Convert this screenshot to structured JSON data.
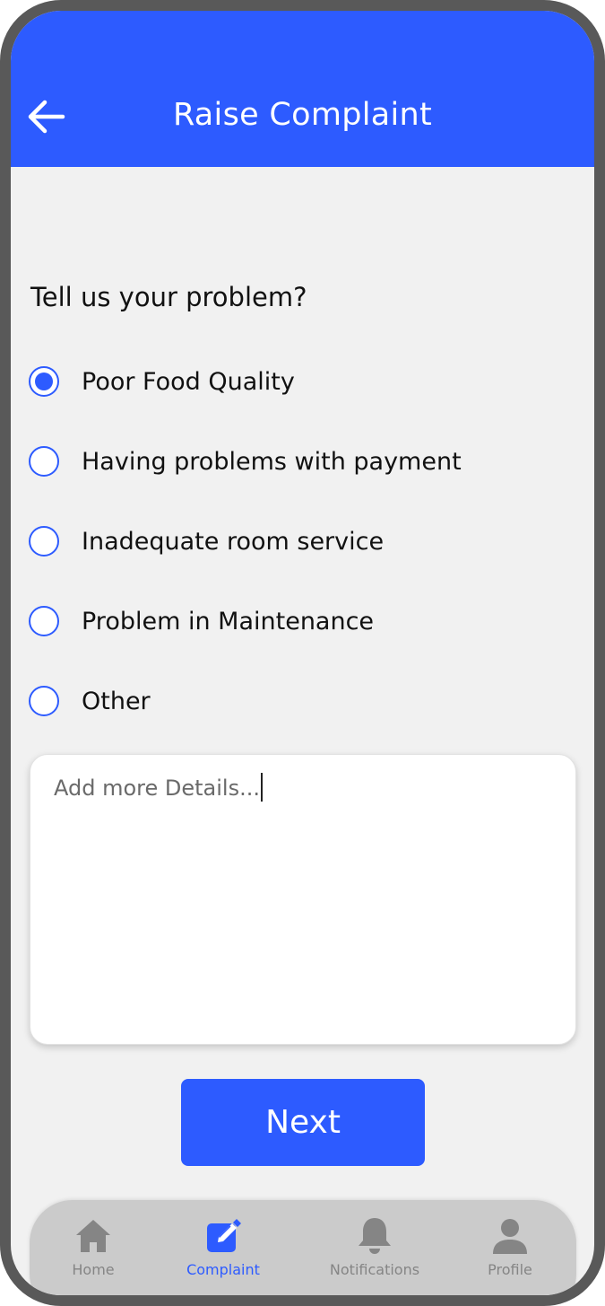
{
  "header": {
    "title": "Raise Complaint",
    "back_icon": "arrow-left-icon",
    "color": "#2d5bff"
  },
  "form": {
    "question": "Tell us your problem?",
    "options": [
      {
        "label": "Poor Food Quality",
        "selected": true
      },
      {
        "label": "Having problems with payment",
        "selected": false
      },
      {
        "label": "Inadequate room service",
        "selected": false
      },
      {
        "label": "Problem in Maintenance",
        "selected": false
      },
      {
        "label": "Other",
        "selected": false
      }
    ],
    "details_placeholder": "Add more Details...",
    "details_value": ""
  },
  "actions": {
    "next_label": "Next"
  },
  "bottom_nav": {
    "active": "Complaint",
    "items": [
      {
        "label": "Home",
        "icon": "home-icon"
      },
      {
        "label": "Complaint",
        "icon": "edit-icon"
      },
      {
        "label": "Notifications",
        "icon": "bell-icon"
      },
      {
        "label": "Profile",
        "icon": "user-icon"
      }
    ]
  },
  "colors": {
    "accent": "#2d5bff",
    "background": "#f1f1f1",
    "frame": "#595959",
    "nav_background": "#cbcbcb",
    "nav_inactive": "#858585"
  }
}
